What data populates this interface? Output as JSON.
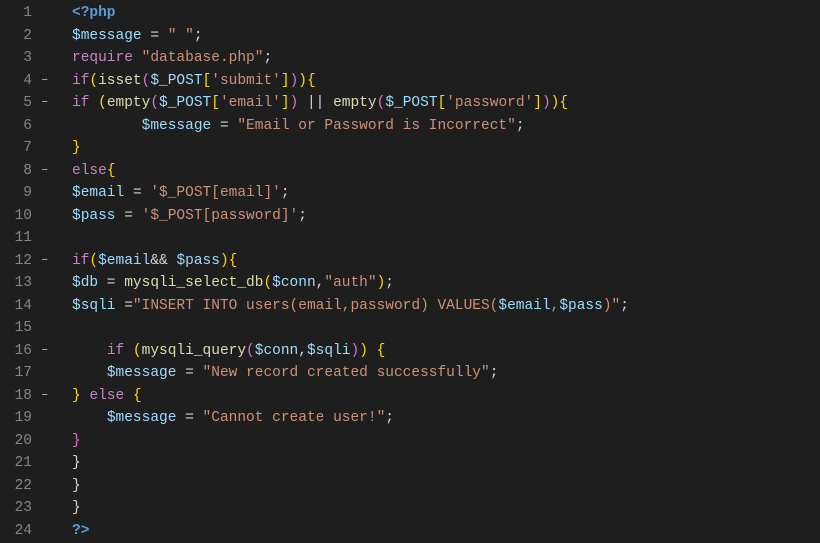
{
  "lines": [
    {
      "num": "1",
      "fold": false,
      "tokens": [
        {
          "t": "<?php",
          "c": "t-phptag"
        }
      ]
    },
    {
      "num": "2",
      "fold": false,
      "tokens": [
        {
          "t": "$message",
          "c": "t-var"
        },
        {
          "t": " = ",
          "c": "t-op"
        },
        {
          "t": "\" \"",
          "c": "t-string"
        },
        {
          "t": ";",
          "c": "t-punct"
        }
      ]
    },
    {
      "num": "3",
      "fold": false,
      "tokens": [
        {
          "t": "require",
          "c": "t-keyword"
        },
        {
          "t": " ",
          "c": "t-op"
        },
        {
          "t": "\"database.php\"",
          "c": "t-string"
        },
        {
          "t": ";",
          "c": "t-punct"
        }
      ]
    },
    {
      "num": "4",
      "fold": true,
      "tokens": [
        {
          "t": "if",
          "c": "t-keyword"
        },
        {
          "t": "(",
          "c": "t-brace"
        },
        {
          "t": "isset",
          "c": "t-func"
        },
        {
          "t": "(",
          "c": "t-brace2"
        },
        {
          "t": "$_POST",
          "c": "t-var"
        },
        {
          "t": "[",
          "c": "t-brace"
        },
        {
          "t": "'submit'",
          "c": "t-string"
        },
        {
          "t": "]",
          "c": "t-brace"
        },
        {
          "t": ")",
          "c": "t-brace2"
        },
        {
          "t": ")",
          "c": "t-brace"
        },
        {
          "t": "{",
          "c": "t-brace"
        }
      ]
    },
    {
      "num": "5",
      "fold": true,
      "tokens": [
        {
          "t": "if",
          "c": "t-keyword"
        },
        {
          "t": " ",
          "c": "t-op"
        },
        {
          "t": "(",
          "c": "t-brace"
        },
        {
          "t": "empty",
          "c": "t-func"
        },
        {
          "t": "(",
          "c": "t-brace2"
        },
        {
          "t": "$_POST",
          "c": "t-var"
        },
        {
          "t": "[",
          "c": "t-brace"
        },
        {
          "t": "'email'",
          "c": "t-string"
        },
        {
          "t": "]",
          "c": "t-brace"
        },
        {
          "t": ")",
          "c": "t-brace2"
        },
        {
          "t": " || ",
          "c": "t-op"
        },
        {
          "t": "empty",
          "c": "t-func"
        },
        {
          "t": "(",
          "c": "t-brace2"
        },
        {
          "t": "$_POST",
          "c": "t-var"
        },
        {
          "t": "[",
          "c": "t-brace"
        },
        {
          "t": "'password'",
          "c": "t-string"
        },
        {
          "t": "]",
          "c": "t-brace"
        },
        {
          "t": ")",
          "c": "t-brace2"
        },
        {
          "t": ")",
          "c": "t-brace"
        },
        {
          "t": "{",
          "c": "t-brace"
        }
      ]
    },
    {
      "num": "6",
      "fold": false,
      "tokens": [
        {
          "t": "        ",
          "c": "t-op"
        },
        {
          "t": "$message",
          "c": "t-var"
        },
        {
          "t": " = ",
          "c": "t-op"
        },
        {
          "t": "\"Email or Password is Incorrect\"",
          "c": "t-string"
        },
        {
          "t": ";",
          "c": "t-punct"
        }
      ]
    },
    {
      "num": "7",
      "fold": false,
      "tokens": [
        {
          "t": "}",
          "c": "t-brace"
        }
      ]
    },
    {
      "num": "8",
      "fold": true,
      "tokens": [
        {
          "t": "else",
          "c": "t-keyword"
        },
        {
          "t": "{",
          "c": "t-brace"
        }
      ]
    },
    {
      "num": "9",
      "fold": false,
      "tokens": [
        {
          "t": "$email",
          "c": "t-var"
        },
        {
          "t": " = ",
          "c": "t-op"
        },
        {
          "t": "'$_POST[email]'",
          "c": "t-string"
        },
        {
          "t": ";",
          "c": "t-punct"
        }
      ]
    },
    {
      "num": "10",
      "fold": false,
      "tokens": [
        {
          "t": "$pass",
          "c": "t-var"
        },
        {
          "t": " = ",
          "c": "t-op"
        },
        {
          "t": "'$_POST[password]'",
          "c": "t-string"
        },
        {
          "t": ";",
          "c": "t-punct"
        }
      ]
    },
    {
      "num": "11",
      "fold": false,
      "tokens": []
    },
    {
      "num": "12",
      "fold": true,
      "tokens": [
        {
          "t": "if",
          "c": "t-keyword"
        },
        {
          "t": "(",
          "c": "t-brace"
        },
        {
          "t": "$email",
          "c": "t-var"
        },
        {
          "t": "&& ",
          "c": "t-op"
        },
        {
          "t": "$pass",
          "c": "t-var"
        },
        {
          "t": ")",
          "c": "t-brace"
        },
        {
          "t": "{",
          "c": "t-brace"
        }
      ]
    },
    {
      "num": "13",
      "fold": false,
      "tokens": [
        {
          "t": "$db",
          "c": "t-var"
        },
        {
          "t": " = ",
          "c": "t-op"
        },
        {
          "t": "mysqli_select_db",
          "c": "t-func"
        },
        {
          "t": "(",
          "c": "t-brace"
        },
        {
          "t": "$conn",
          "c": "t-var"
        },
        {
          "t": ",",
          "c": "t-punct"
        },
        {
          "t": "\"auth\"",
          "c": "t-string"
        },
        {
          "t": ")",
          "c": "t-brace"
        },
        {
          "t": ";",
          "c": "t-punct"
        }
      ]
    },
    {
      "num": "14",
      "fold": false,
      "tokens": [
        {
          "t": "$sqli",
          "c": "t-var"
        },
        {
          "t": " =",
          "c": "t-op"
        },
        {
          "t": "\"INSERT INTO users(email,password) VALUES(",
          "c": "t-string"
        },
        {
          "t": "$email",
          "c": "t-var"
        },
        {
          "t": ",",
          "c": "t-string"
        },
        {
          "t": "$pass",
          "c": "t-var"
        },
        {
          "t": ")\"",
          "c": "t-string"
        },
        {
          "t": ";",
          "c": "t-punct"
        }
      ]
    },
    {
      "num": "15",
      "fold": false,
      "tokens": []
    },
    {
      "num": "16",
      "fold": true,
      "tokens": [
        {
          "t": "    ",
          "c": "t-op"
        },
        {
          "t": "if",
          "c": "t-keyword"
        },
        {
          "t": " ",
          "c": "t-op"
        },
        {
          "t": "(",
          "c": "t-brace"
        },
        {
          "t": "mysqli_query",
          "c": "t-func"
        },
        {
          "t": "(",
          "c": "t-brace2"
        },
        {
          "t": "$conn",
          "c": "t-var"
        },
        {
          "t": ",",
          "c": "t-punct"
        },
        {
          "t": "$sqli",
          "c": "t-var"
        },
        {
          "t": ")",
          "c": "t-brace2"
        },
        {
          "t": ")",
          "c": "t-brace"
        },
        {
          "t": " ",
          "c": "t-op"
        },
        {
          "t": "{",
          "c": "t-brace"
        }
      ]
    },
    {
      "num": "17",
      "fold": false,
      "tokens": [
        {
          "t": "    ",
          "c": "t-op"
        },
        {
          "t": "$message",
          "c": "t-var"
        },
        {
          "t": " = ",
          "c": "t-op"
        },
        {
          "t": "\"New record created successfully\"",
          "c": "t-string"
        },
        {
          "t": ";",
          "c": "t-punct"
        }
      ]
    },
    {
      "num": "18",
      "fold": true,
      "tokens": [
        {
          "t": "}",
          "c": "t-brace"
        },
        {
          "t": " ",
          "c": "t-op"
        },
        {
          "t": "else",
          "c": "t-keyword"
        },
        {
          "t": " ",
          "c": "t-op"
        },
        {
          "t": "{",
          "c": "t-brace"
        }
      ]
    },
    {
      "num": "19",
      "fold": false,
      "tokens": [
        {
          "t": "    ",
          "c": "t-op"
        },
        {
          "t": "$message",
          "c": "t-var"
        },
        {
          "t": " = ",
          "c": "t-op"
        },
        {
          "t": "\"Cannot create user!\"",
          "c": "t-string"
        },
        {
          "t": ";",
          "c": "t-punct"
        }
      ]
    },
    {
      "num": "20",
      "fold": false,
      "tokens": [
        {
          "t": "}",
          "c": "t-brace2"
        }
      ]
    },
    {
      "num": "21",
      "fold": false,
      "tokens": [
        {
          "t": "}",
          "c": "t-punct"
        }
      ]
    },
    {
      "num": "22",
      "fold": false,
      "tokens": [
        {
          "t": "}",
          "c": "t-punct"
        }
      ]
    },
    {
      "num": "23",
      "fold": false,
      "tokens": [
        {
          "t": "}",
          "c": "t-punct"
        }
      ]
    },
    {
      "num": "24",
      "fold": false,
      "tokens": [
        {
          "t": "?>",
          "c": "t-phptag"
        }
      ]
    }
  ]
}
